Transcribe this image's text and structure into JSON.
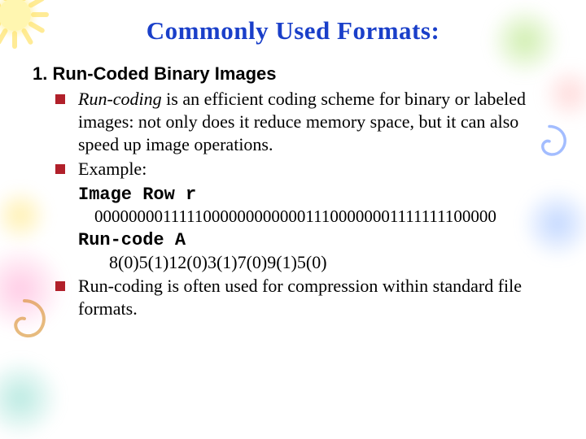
{
  "title": "Commonly Used Formats:",
  "section": {
    "number": "1.",
    "heading": "Run‑Coded Binary Images"
  },
  "bullets": {
    "b1": {
      "emph": "Run‑coding",
      "rest": " is an efficient coding scheme for binary or labeled images: not only does it reduce memory space, but it can also speed up image operations."
    },
    "b2": {
      "line1": "Example:",
      "label": "Image Row r",
      "binary": "000000001111100000000000011100000001111111100000",
      "runcode_label": "Run‑code A",
      "runcode_value": "8(0)5(1)12(0)3(1)7(0)9(1)5(0)"
    },
    "b3": {
      "text": "Run‑coding is often used for compression within standard file formats."
    }
  }
}
